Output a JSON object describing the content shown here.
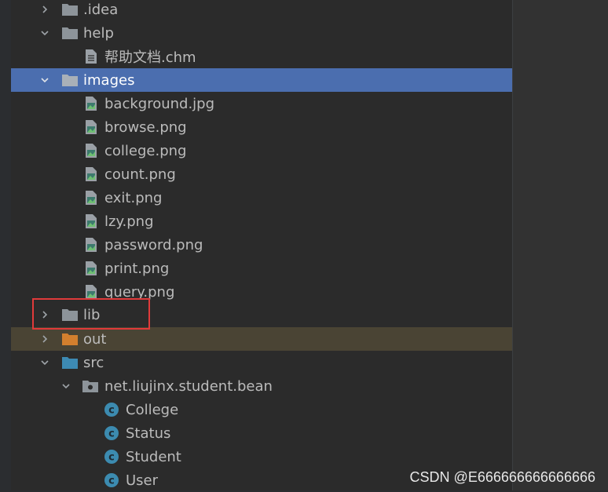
{
  "tree": [
    {
      "label": ".idea",
      "type": "folder",
      "expanded": false
    },
    {
      "label": "help",
      "type": "folder",
      "expanded": true
    },
    {
      "label": "帮助文档.chm",
      "type": "file"
    },
    {
      "label": "images",
      "type": "folder",
      "expanded": true,
      "selected": true
    },
    {
      "label": "background.jpg",
      "type": "image"
    },
    {
      "label": "browse.png",
      "type": "image"
    },
    {
      "label": "college.png",
      "type": "image"
    },
    {
      "label": "count.png",
      "type": "image"
    },
    {
      "label": "exit.png",
      "type": "image"
    },
    {
      "label": "lzy.png",
      "type": "image"
    },
    {
      "label": "password.png",
      "type": "image"
    },
    {
      "label": "print.png",
      "type": "image"
    },
    {
      "label": "query.png",
      "type": "image"
    },
    {
      "label": "lib",
      "type": "folder",
      "expanded": false,
      "highlighted": true
    },
    {
      "label": "out",
      "type": "folder-excluded",
      "expanded": false
    },
    {
      "label": "src",
      "type": "folder-source",
      "expanded": true
    },
    {
      "label": "net.liujinx.student.bean",
      "type": "package",
      "expanded": true
    },
    {
      "label": "College",
      "type": "class"
    },
    {
      "label": "Status",
      "type": "class"
    },
    {
      "label": "Student",
      "type": "class"
    },
    {
      "label": "User",
      "type": "class"
    }
  ],
  "watermark": "CSDN @E666666666666666",
  "colors": {
    "selection": "#4b6eaf",
    "excluded_row": "#4a4434",
    "highlight_box": "#e03a3a",
    "folder": "#8d949a",
    "excluded_folder": "#d27f2e",
    "source_folder": "#3d8ab3",
    "class_icon": "#3c8bb0"
  }
}
